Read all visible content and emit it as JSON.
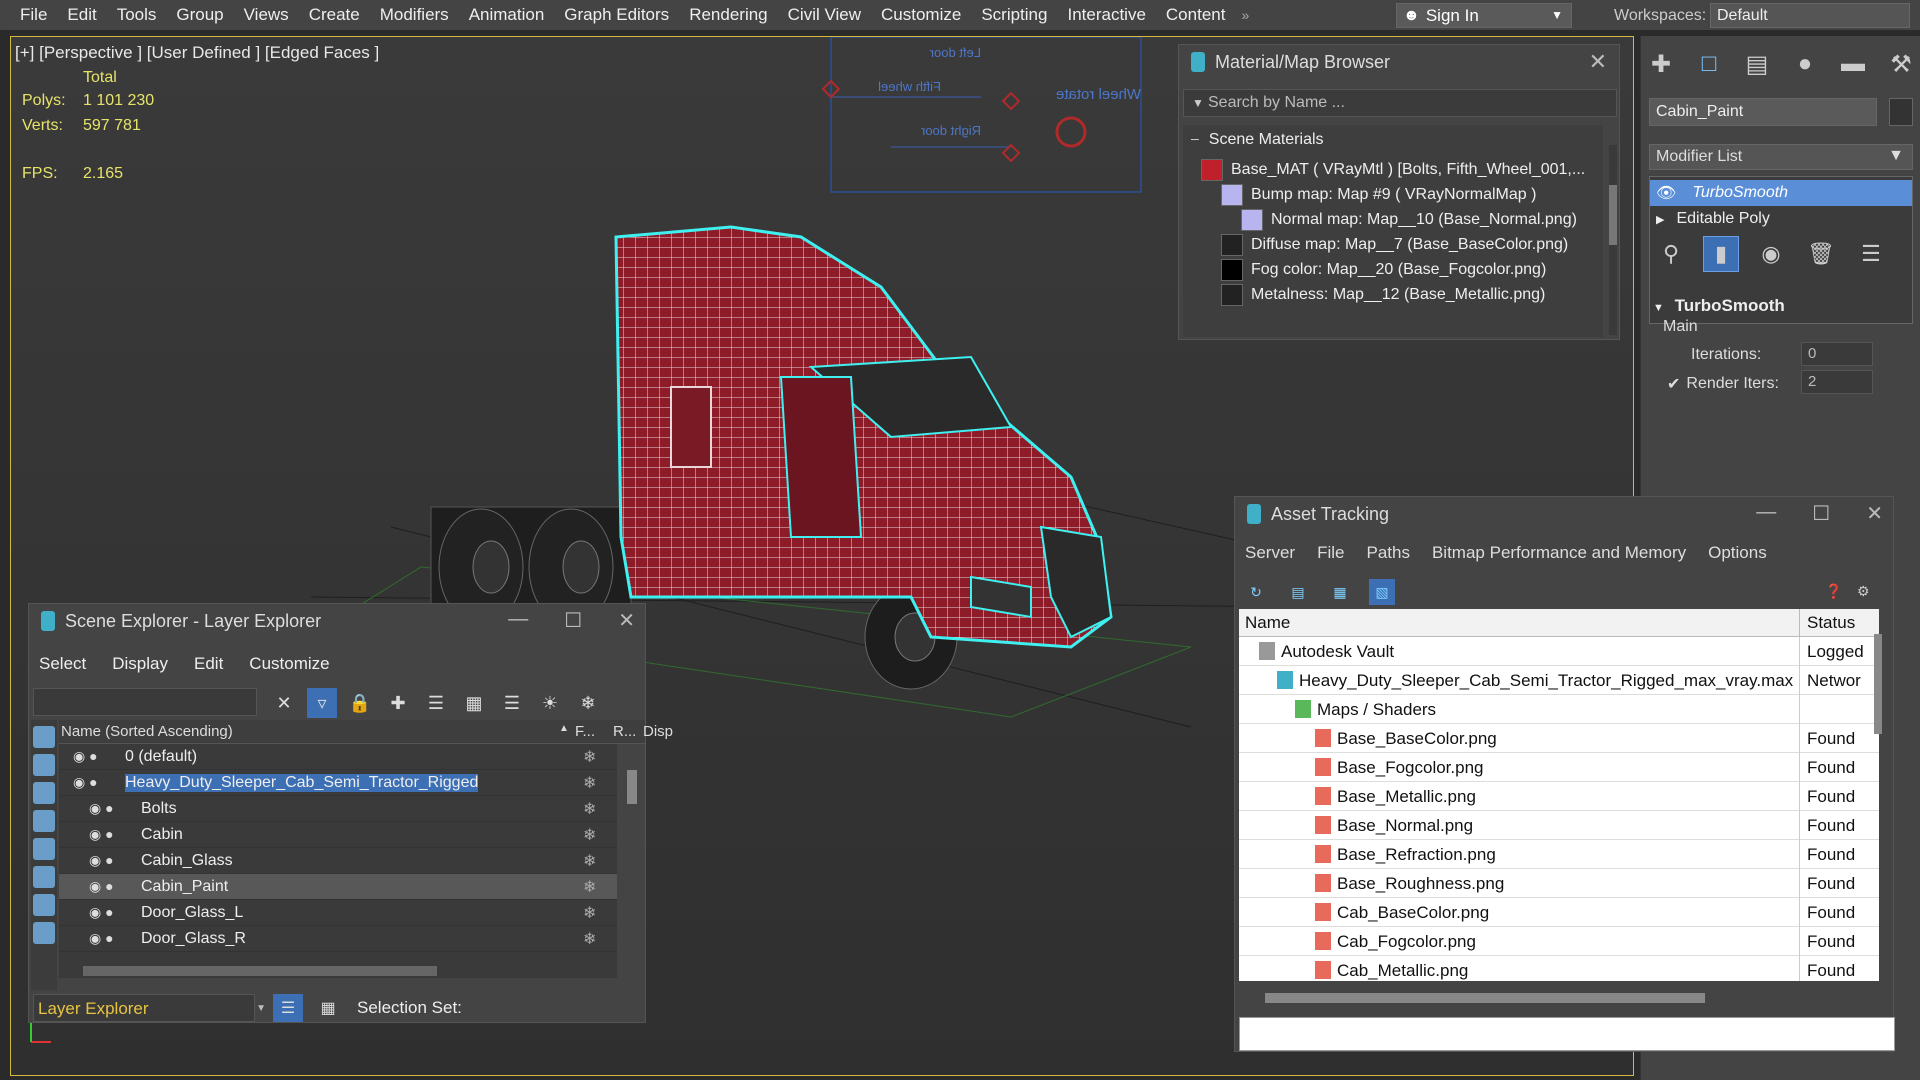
{
  "menu": [
    "File",
    "Edit",
    "Tools",
    "Group",
    "Views",
    "Create",
    "Modifiers",
    "Animation",
    "Graph Editors",
    "Rendering",
    "Civil View",
    "Customize",
    "Scripting",
    "Interactive",
    "Content"
  ],
  "menu_more": "»",
  "signin": "Sign In",
  "workspaces_label": "Workspaces:",
  "workspace_value": "Default",
  "viewport": {
    "label": "[+] [Perspective ] [User Defined ] [Edged Faces ]",
    "total_label": "Total",
    "polys_label": "Polys:",
    "polys_value": "1 101 230",
    "verts_label": "Verts:",
    "verts_value": "597 781",
    "fps_label": "FPS:",
    "fps_value": "2.165",
    "rig_labels": [
      "Left door",
      "Fifth wheel",
      "Wheel rotate",
      "Right door"
    ]
  },
  "material_browser": {
    "title": "Material/Map Browser",
    "search_placeholder": "Search by Name ...",
    "group": "Scene Materials",
    "rows": [
      {
        "text": "Base_MAT  ( VRayMtl )  [Bolts, Fifth_Wheel_001,...",
        "color": "#c0202a"
      },
      {
        "text": "Bump map: Map #9  ( VRayNormalMap )",
        "color": "#b8b4f0"
      },
      {
        "text": "Normal map: Map__10 (Base_Normal.png)",
        "color": "#b8b4f0"
      },
      {
        "text": "Diffuse map: Map__7 (Base_BaseColor.png)",
        "color": "#222222"
      },
      {
        "text": "Fog color: Map__20 (Base_Fogcolor.png)",
        "color": "#000000"
      },
      {
        "text": "Metalness: Map__12 (Base_Metallic.png)",
        "color": "#222222"
      }
    ]
  },
  "command_panel": {
    "object_name": "Cabin_Paint",
    "modifier_list": "Modifier List",
    "stack": [
      "TurboSmooth",
      "Editable Poly"
    ],
    "rollout_title": "TurboSmooth",
    "main_label": "Main",
    "iterations_label": "Iterations:",
    "iterations_value": "0",
    "render_iters_label": "Render Iters:",
    "render_iters_value": "2",
    "render_iters_checked": true
  },
  "scene_explorer": {
    "title": "Scene Explorer - Layer Explorer",
    "menu": [
      "Select",
      "Display",
      "Edit",
      "Customize"
    ],
    "col_name": "Name (Sorted Ascending)",
    "col_f": "F...",
    "col_r": "R...",
    "col_disp": "Disp",
    "rows": [
      {
        "name": "0 (default)",
        "level": 0
      },
      {
        "name": "Heavy_Duty_Sleeper_Cab_Semi_Tractor_Rigged",
        "level": 0
      },
      {
        "name": "Bolts",
        "level": 1
      },
      {
        "name": "Cabin",
        "level": 1
      },
      {
        "name": "Cabin_Glass",
        "level": 1
      },
      {
        "name": "Cabin_Paint",
        "level": 1
      },
      {
        "name": "Door_Glass_L",
        "level": 1
      },
      {
        "name": "Door_Glass_R",
        "level": 1
      }
    ],
    "footer_dropdown": "Layer Explorer",
    "selection_set_label": "Selection Set:"
  },
  "asset_tracking": {
    "title": "Asset Tracking",
    "menu": [
      "Server",
      "File",
      "Paths",
      "Bitmap Performance and Memory",
      "Options"
    ],
    "col_name": "Name",
    "col_status": "Status",
    "rows": [
      {
        "name": "Autodesk Vault",
        "status": "Logged",
        "indent": 1
      },
      {
        "name": "Heavy_Duty_Sleeper_Cab_Semi_Tractor_Rigged_max_vray.max",
        "status": "Networ",
        "indent": 2
      },
      {
        "name": "Maps / Shaders",
        "status": "",
        "indent": 3
      },
      {
        "name": "Base_BaseColor.png",
        "status": "Found",
        "indent": 4
      },
      {
        "name": "Base_Fogcolor.png",
        "status": "Found",
        "indent": 4
      },
      {
        "name": "Base_Metallic.png",
        "status": "Found",
        "indent": 4
      },
      {
        "name": "Base_Normal.png",
        "status": "Found",
        "indent": 4
      },
      {
        "name": "Base_Refraction.png",
        "status": "Found",
        "indent": 4
      },
      {
        "name": "Base_Roughness.png",
        "status": "Found",
        "indent": 4
      },
      {
        "name": "Cab_BaseColor.png",
        "status": "Found",
        "indent": 4
      },
      {
        "name": "Cab_Fogcolor.png",
        "status": "Found",
        "indent": 4
      },
      {
        "name": "Cab_Metallic.png",
        "status": "Found",
        "indent": 4
      }
    ]
  },
  "colors": {
    "accent": "#3c6fb4",
    "selection_outline": "#3ff0f0",
    "wire_red": "#9b1c2a",
    "stat_yellow": "#e7e36a"
  }
}
